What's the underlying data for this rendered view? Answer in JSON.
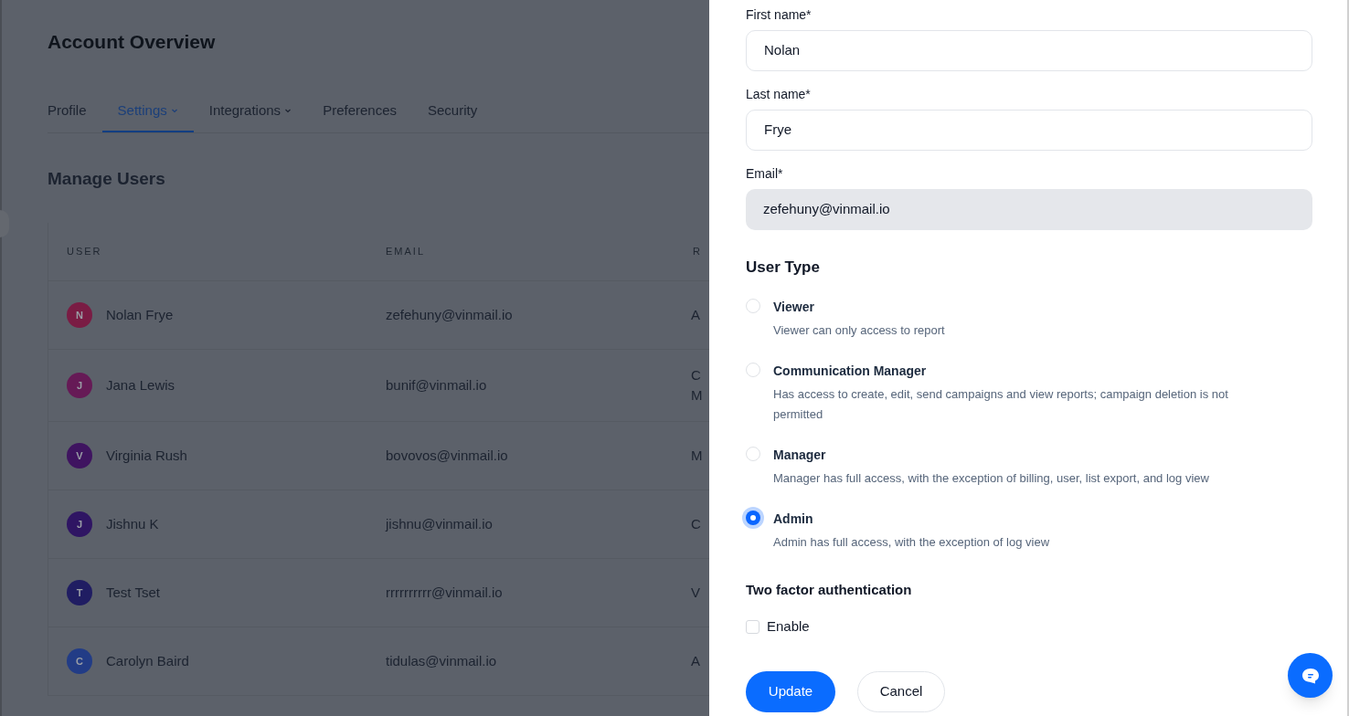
{
  "page": {
    "title": "Account Overview",
    "tabs": [
      {
        "label": "Profile",
        "selected": false,
        "dropdown": false
      },
      {
        "label": "Settings",
        "selected": true,
        "dropdown": true
      },
      {
        "label": "Integrations",
        "selected": false,
        "dropdown": true
      },
      {
        "label": "Preferences",
        "selected": false,
        "dropdown": false
      },
      {
        "label": "Security",
        "selected": false,
        "dropdown": false
      }
    ],
    "section_title": "Manage Users",
    "table": {
      "columns": [
        "USER",
        "EMAIL",
        "R"
      ],
      "rows": [
        {
          "initial": "N",
          "color": "#7a1c44",
          "name": "Nolan Frye",
          "email": "zefehuny@vinmail.io",
          "column_3": [
            "A"
          ]
        },
        {
          "initial": "J",
          "color": "#661a56",
          "name": "Jana Lewis",
          "email": "bunif@vinmail.io",
          "column_3": [
            "C",
            "M"
          ]
        },
        {
          "initial": "V",
          "color": "#3f1460",
          "name": "Virginia Rush",
          "email": "bovovos@vinmail.io",
          "column_3": [
            "M"
          ]
        },
        {
          "initial": "J",
          "color": "#2f1563",
          "name": "Jishnu K",
          "email": "jishnu@vinmail.io",
          "column_3": [
            "C"
          ]
        },
        {
          "initial": "T",
          "color": "#201d62",
          "name": "Test Tset",
          "email": "rrrrrrrrrr@vinmail.io",
          "column_3": [
            "V"
          ]
        },
        {
          "initial": "C",
          "color": "#223c86",
          "name": "Carolyn Baird",
          "email": "tidulas@vinmail.io",
          "column_3": [
            "A"
          ]
        }
      ]
    }
  },
  "drawer": {
    "fields": [
      {
        "label": "First name*",
        "value": "Nolan",
        "disabled": false
      },
      {
        "label": "Last name*",
        "value": "Frye",
        "disabled": false
      },
      {
        "label": "Email*",
        "value": "zefehuny@vinmail.io",
        "disabled": true
      }
    ],
    "user_type_title": "User Type",
    "user_types": [
      {
        "label": "Viewer",
        "description": "Viewer can only access to report",
        "selected": false
      },
      {
        "label": "Communication Manager",
        "description": "Has access to create, edit, send campaigns and view reports; campaign deletion is not permitted",
        "selected": false
      },
      {
        "label": "Manager",
        "description": "Manager has full access, with the exception of billing, user, list export, and log view",
        "selected": false
      },
      {
        "label": "Admin",
        "description": "Admin has full access, with the exception of log view",
        "selected": true
      }
    ],
    "two_factor_title": "Two factor authentication",
    "two_factor": {
      "label": "Enable",
      "checked": false
    },
    "buttons": [
      {
        "label": "Update",
        "kind": "primary"
      },
      {
        "label": "Cancel",
        "kind": "secondary"
      }
    ]
  }
}
